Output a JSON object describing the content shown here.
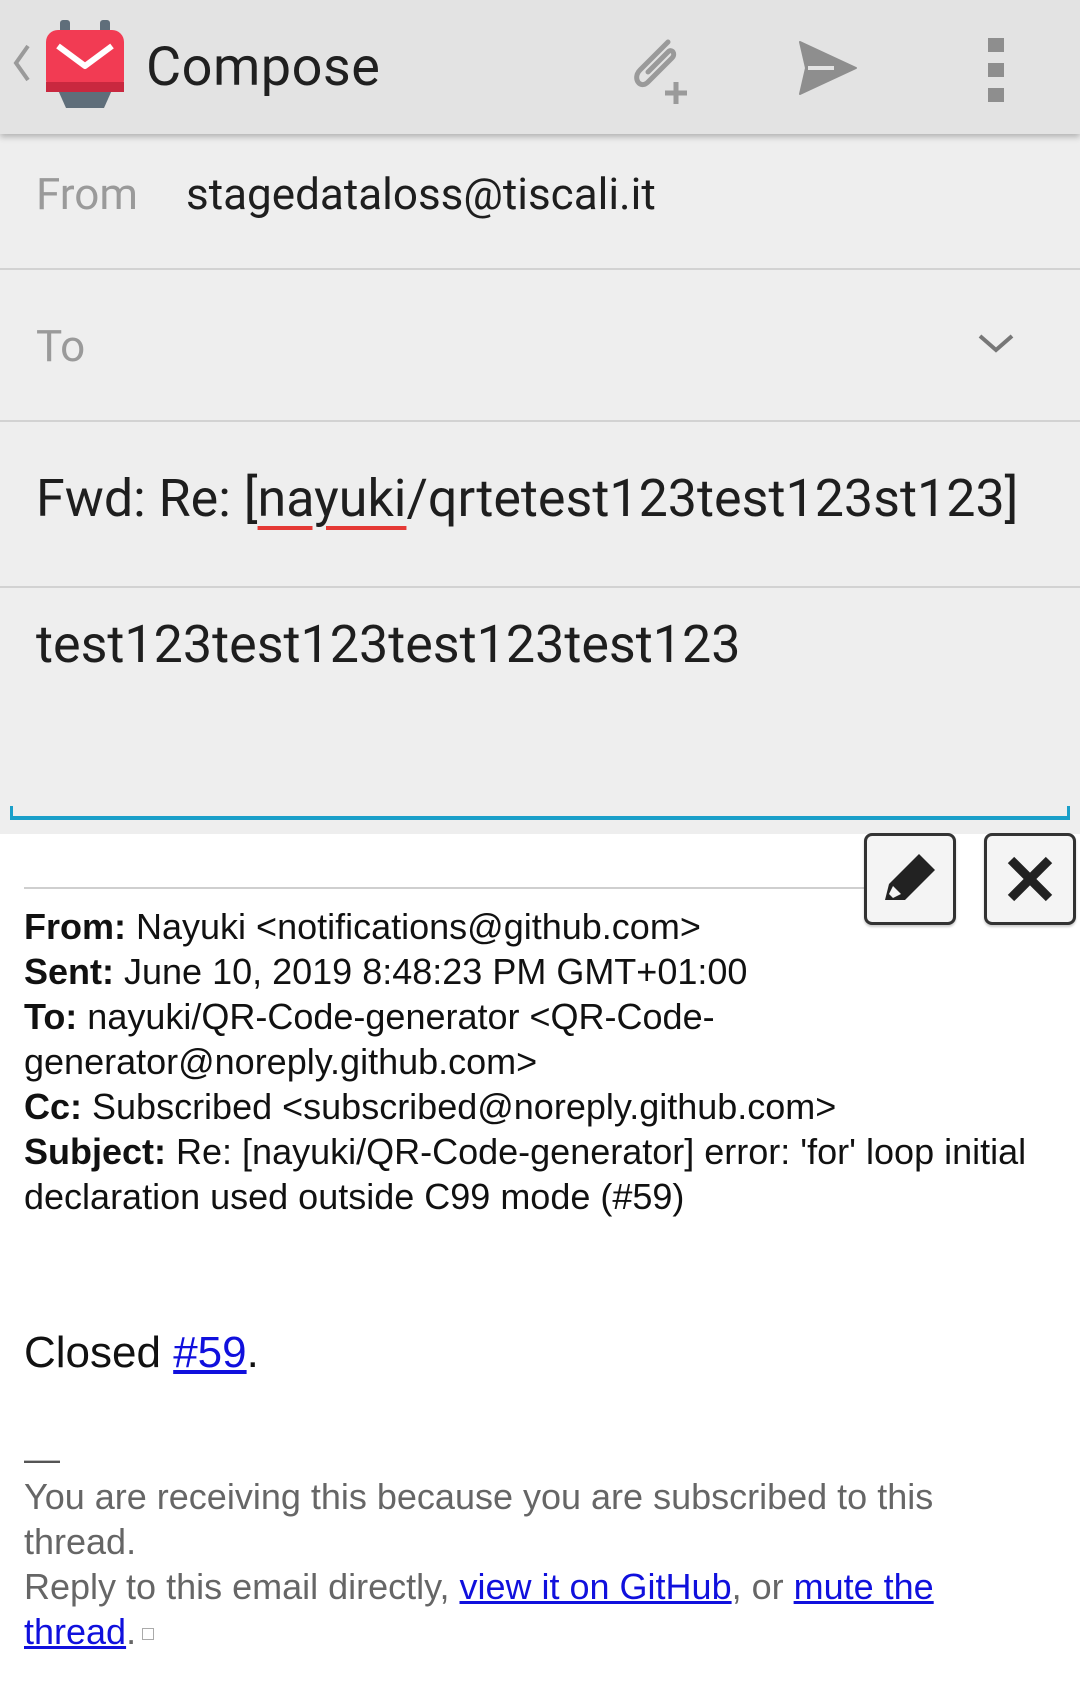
{
  "action_bar": {
    "title": "Compose",
    "icons": [
      "back-chevron-icon",
      "k9-mail-logo-icon",
      "attach-file-icon",
      "send-icon",
      "overflow-menu-icon"
    ]
  },
  "compose": {
    "from_label": "From",
    "from_value": "stagedataloss@tiscali.it",
    "to_label": "To",
    "subject_prefix": "Fwd: Re: [",
    "subject_misspelled": "nayuki",
    "subject_rest": "/qrtetest123test123st123]",
    "body": "test123test123test123test123"
  },
  "quoted": {
    "from_label": "From:",
    "from_value": " Nayuki <notifications@github.com>",
    "sent_label": "Sent:",
    "sent_value": " June 10, 2019 8:48:23 PM GMT+01:00",
    "to_label": "To:",
    "to_value": " nayuki/QR-Code-generator <QR-Code-generator@noreply.github.com>",
    "cc_label": "Cc:",
    "cc_value": " Subscribed <subscribed@noreply.github.com>",
    "subject_label": "Subject:",
    "subject_value": " Re: [nayuki/QR-Code-generator] error: 'for' loop initial declaration used outside C99 mode (#59)",
    "closed_text": "Closed ",
    "closed_link": "#59",
    "closed_end": ".",
    "dash": "—",
    "footer_line1": "You are receiving this because you are subscribed to this thread.",
    "footer_line2_start": "Reply to this email directly, ",
    "footer_link1": "view it on GitHub",
    "footer_mid": ", or ",
    "footer_link2": "mute the thread",
    "footer_end": "."
  },
  "colors": {
    "action_bar_bg": "#e3e3e3",
    "compose_bg": "#eeeeee",
    "focus_accent": "#1a9fc9",
    "link": "#1010dd",
    "spellcheck": "#e53935",
    "logo_red": "#f23b53"
  }
}
